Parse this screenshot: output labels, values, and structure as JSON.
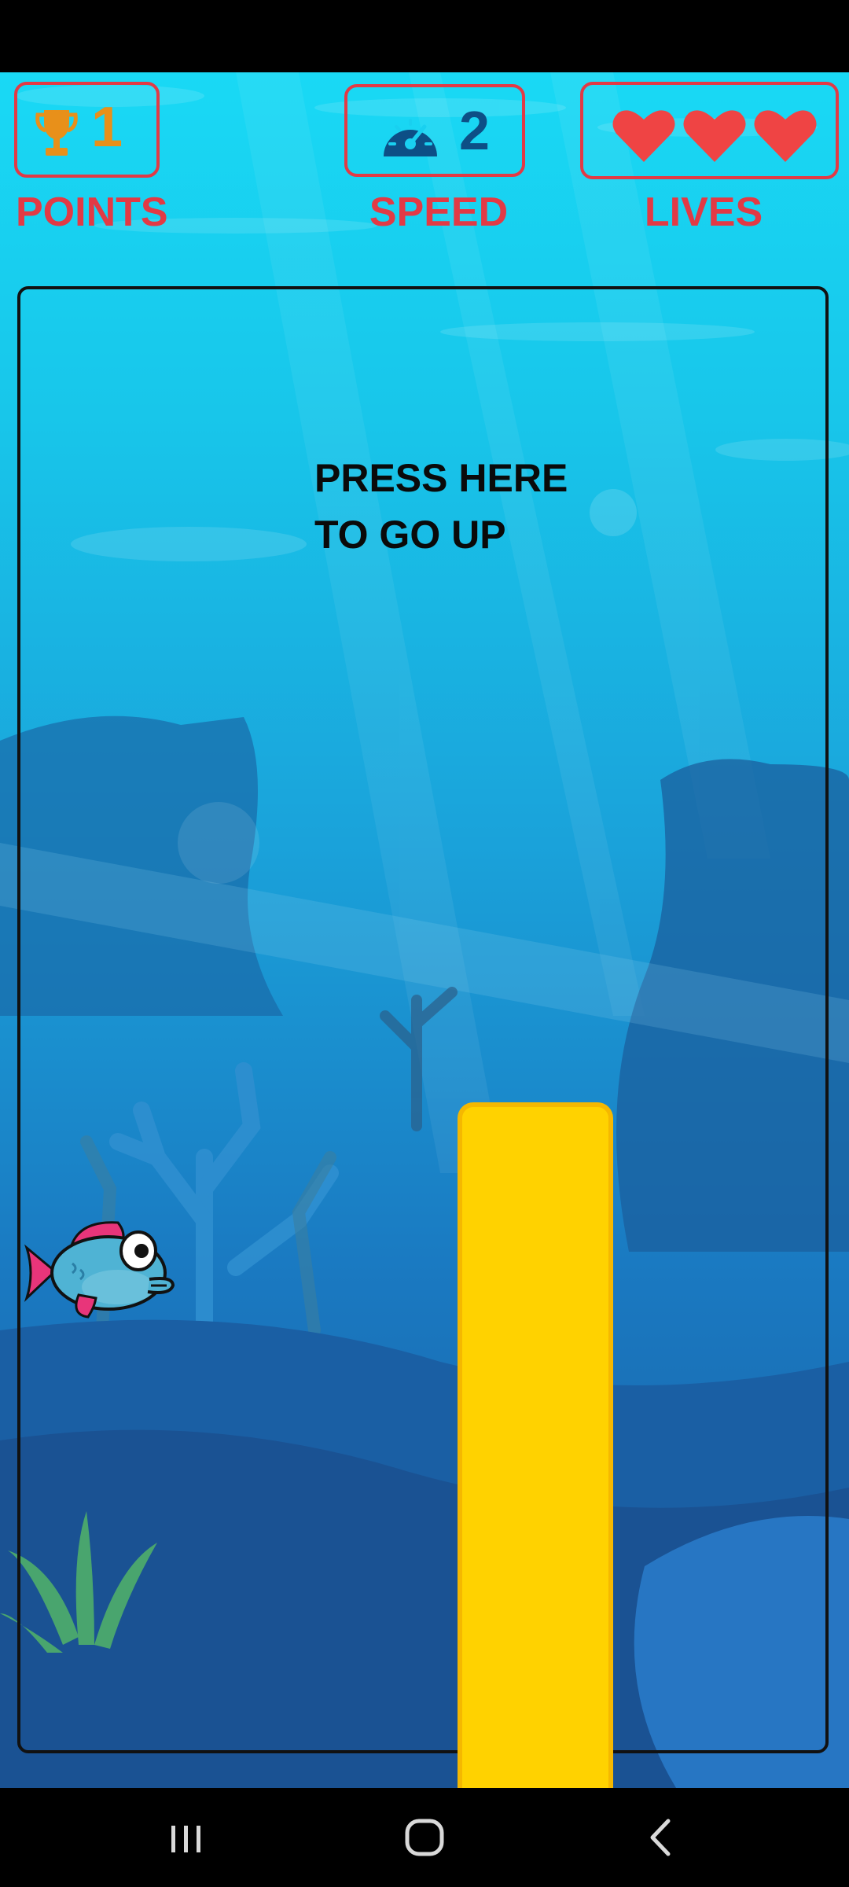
{
  "hud": {
    "points": {
      "value": "1",
      "label": "POINTS",
      "icon": "trophy-icon"
    },
    "speed": {
      "value": "2",
      "label": "SPEED",
      "icon": "speedometer-icon"
    },
    "lives": {
      "count": 3,
      "label": "LIVES",
      "icon": "heart-icon"
    }
  },
  "instruction": {
    "line1": "PRESS HERE",
    "line2": "TO GO UP"
  },
  "colors": {
    "hud_red": "#e23a45",
    "trophy": "#e8901a",
    "speed_navy": "#0d4f86",
    "pillar": "#ffd200",
    "water_top": "#19d9f5",
    "water_bottom": "#1a5b9e"
  },
  "nav": {
    "recents_icon": "recents-icon",
    "home_icon": "home-icon",
    "back_icon": "back-icon"
  }
}
